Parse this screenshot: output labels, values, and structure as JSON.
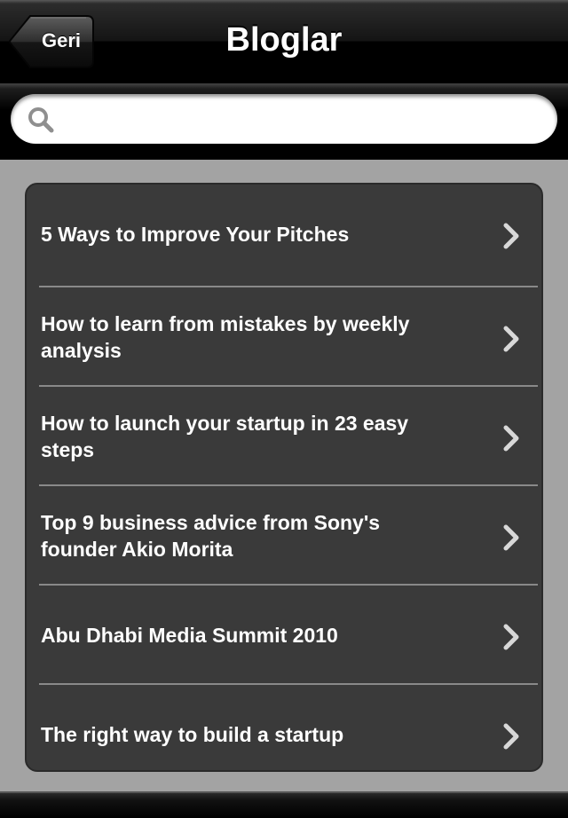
{
  "navbar": {
    "back_label": "Geri",
    "title": "Bloglar"
  },
  "search": {
    "value": "",
    "placeholder": "",
    "icon": "magnifier-icon"
  },
  "list": {
    "items": [
      {
        "label": "5 Ways to Improve Your Pitches"
      },
      {
        "label": "How to learn from mistakes by weekly analysis"
      },
      {
        "label": "How to launch your startup in 23 easy steps"
      },
      {
        "label": "Top 9 business advice from Sony's founder Akio Morita"
      },
      {
        "label": "Abu Dhabi Media Summit 2010"
      },
      {
        "label": "The right way to build a startup"
      }
    ],
    "chevron_icon": "chevron-right-icon"
  },
  "colors": {
    "list_background": "#3a3a3a",
    "page_background": "#a3a3a3",
    "navbar": "#000000",
    "text": "#ffffff"
  }
}
